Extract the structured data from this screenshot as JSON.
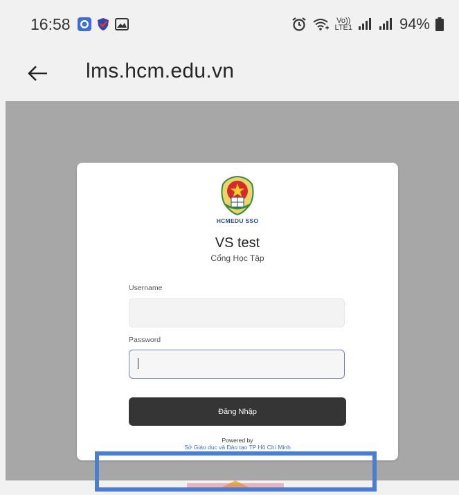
{
  "status_bar": {
    "time": "16:58",
    "icons": [
      "shield-app-icon",
      "vpn-shield-icon",
      "image-icon",
      "alarm-icon",
      "wifi-icon",
      "volte-icon",
      "signal-icon",
      "battery-icon"
    ],
    "volte_top": "Vo))",
    "volte_bottom": "LTE1",
    "battery": "94%"
  },
  "toolbar": {
    "back_icon": "arrow-left-icon",
    "url": "lms.hcm.edu.vn"
  },
  "login": {
    "logo_icon": "hcmedu-emblem-icon",
    "logo_text": "HCMEDU SSO",
    "title": "VS test",
    "subtitle": "Cổng Học Tập",
    "username_label": "Username",
    "username_value": "",
    "password_label": "Password",
    "password_value": "",
    "submit_label": "Đăng Nhập",
    "powered_by": "Powered by",
    "org_name": "Sở Giáo dục và Đào tạo TP Hồ Chí Minh"
  },
  "colors": {
    "page_bg": "#f1f1f1",
    "web_bg": "#a7a7a7",
    "button_bg": "#353535",
    "link": "#3a6fb5",
    "highlight": "#4a7fd0"
  }
}
